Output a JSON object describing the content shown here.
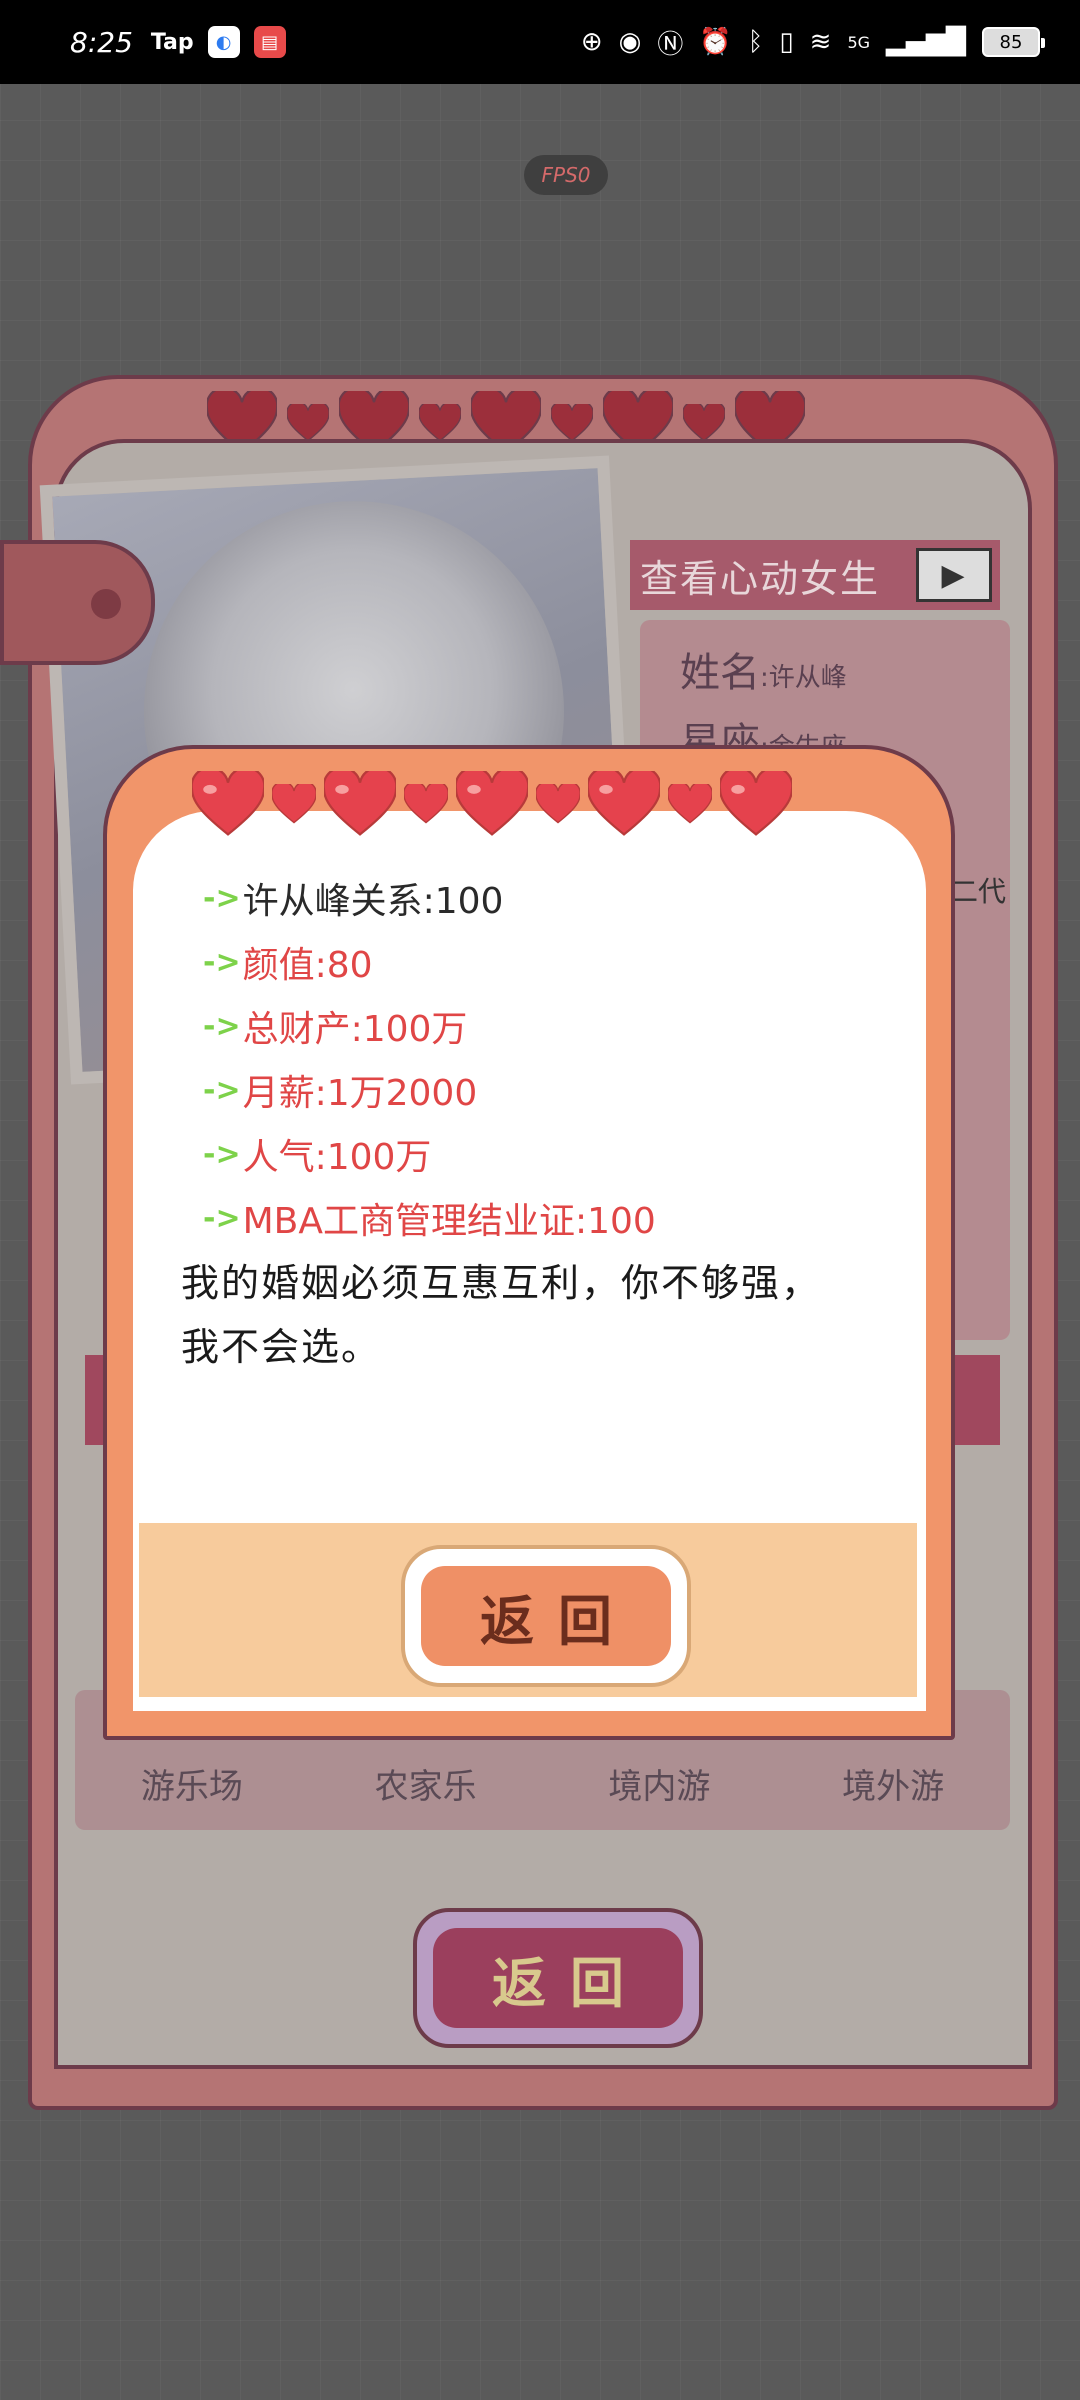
{
  "status_bar": {
    "time": "8:25",
    "tap_label": "Tap",
    "battery": "85",
    "network": "5G"
  },
  "fps_label": "FPS0",
  "background": {
    "view_heartthrob_label": "查看心动女生",
    "name_label": "姓名",
    "name_value": "许从峰",
    "sign_label": "星座",
    "sign_value": "金牛座",
    "extra_text": "二代",
    "places": [
      "游乐场",
      "农家乐",
      "境内游",
      "境外游"
    ],
    "return_label": "返回"
  },
  "modal": {
    "stats": [
      {
        "label": "许从峰关系:100"
      },
      {
        "label": "颜值:80"
      },
      {
        "label": "总财产:100万"
      },
      {
        "label": "月薪:1万2000"
      },
      {
        "label": "人气:100万"
      },
      {
        "label": "MBA工商管理结业证:100"
      }
    ],
    "arrow": "->",
    "quote": "我的婚姻必须互惠互利，你不够强，我不会选。",
    "return_label": "返回"
  },
  "colors": {
    "heart": "#e5424d",
    "modal_frame": "#f1956a",
    "stat_text": "#e04646",
    "arrow": "#7dd24a"
  }
}
